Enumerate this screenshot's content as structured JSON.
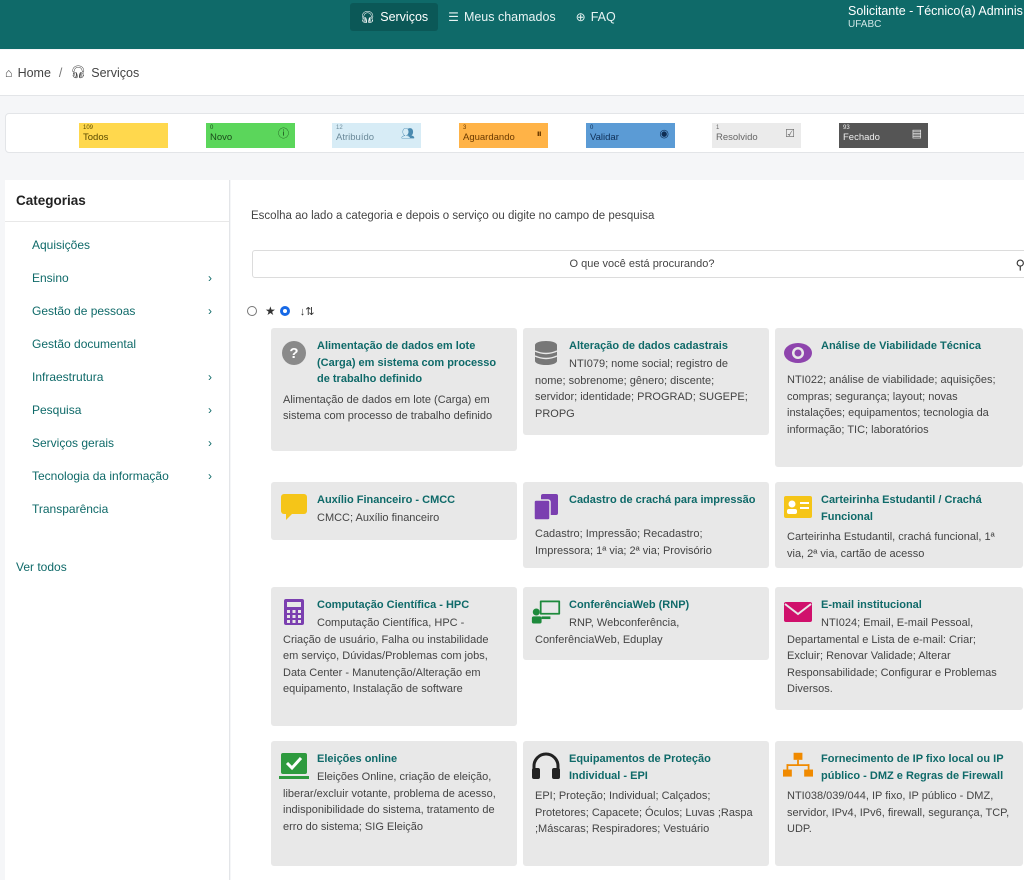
{
  "topbar": {
    "nav": [
      {
        "label": "Serviços",
        "icon": "headset-icon",
        "active": true
      },
      {
        "label": "Meus chamados",
        "icon": "list-icon"
      },
      {
        "label": "FAQ",
        "icon": "lifebuoy-icon"
      }
    ],
    "user": {
      "name": "Solicitante - Técnico(a) Adminis...",
      "org": "UFABC"
    }
  },
  "breadcrumb": {
    "home": "Home",
    "sep": "/",
    "current": "Serviços"
  },
  "status_tiles": [
    {
      "count": "109",
      "label": "Todos",
      "color": "#ffd84d"
    },
    {
      "count": "0",
      "label": "Novo",
      "color": "#5bd65b"
    },
    {
      "count": "12",
      "label": "Atribuído",
      "color": "#cfe6f2"
    },
    {
      "count": "3",
      "label": "Aguardando",
      "color": "#ffb347"
    },
    {
      "count": "0",
      "label": "Validar",
      "color": "#5b9bd5"
    },
    {
      "count": "1",
      "label": "Resolvido",
      "color": "#e8e8e8"
    },
    {
      "count": "93",
      "label": "Fechado",
      "color": "#555555"
    }
  ],
  "sidebar": {
    "title": "Categorias",
    "items": [
      {
        "label": "Aquisições",
        "has_children": false
      },
      {
        "label": "Ensino",
        "has_children": true
      },
      {
        "label": "Gestão de pessoas",
        "has_children": true
      },
      {
        "label": "Gestão documental",
        "has_children": false
      },
      {
        "label": "Infraestrutura",
        "has_children": true
      },
      {
        "label": "Pesquisa",
        "has_children": true
      },
      {
        "label": "Serviços gerais",
        "has_children": true
      },
      {
        "label": "Tecnologia da informação",
        "has_children": true
      },
      {
        "label": "Transparência",
        "has_children": false
      }
    ],
    "see_all": "Ver todos"
  },
  "main": {
    "hint": "Escolha ao lado a categoria e depois o serviço ou digite no campo de pesquisa",
    "search_placeholder": "O que você está procurando?",
    "cards": [
      {
        "title": "Alimentação de dados em lote (Carga) em sistema com processo de trabalho definido",
        "desc": "Alimentação de dados em lote (Carga) em sistema com processo de trabalho definido",
        "icon": "question-icon"
      },
      {
        "title": "Alteração de dados cadastrais",
        "desc": "NTI079; nome social; registro de nome; sobrenome; gênero; discente; servidor; identidade; PROGRAD; SUGEPE; PROPG",
        "icon": "database-icon"
      },
      {
        "title": "Análise de Viabilidade Técnica",
        "desc": "NTI022; análise de viabilidade; aquisições; compras; segurança; layout; novas instalações; equipamentos; tecnologia da informação; TIC; laboratórios",
        "icon": "eye-icon"
      },
      {
        "title": "Auxílio Financeiro - CMCC",
        "desc": "CMCC; Auxílio financeiro",
        "icon": "comment-icon"
      },
      {
        "title": "Cadastro de crachá para impressão",
        "desc": "Cadastro; Impressão; Recadastro; Impressora; 1ª via; 2ª via; Provisório",
        "icon": "copy-icon"
      },
      {
        "title": "Carteirinha Estudantil / Crachá Funcional",
        "desc": "Carteirinha Estudantil, crachá funcional, 1ª via, 2ª via, cartão de acesso",
        "icon": "id-card-icon"
      },
      {
        "title": "Computação Científica - HPC",
        "desc": "Computação Científica, HPC - Criação de usuário, Falha ou instabilidade em serviço, Dúvidas/Problemas com jobs, Data Center - Manutenção/Alteração em equipamento, Instalação de software",
        "icon": "calculator-icon"
      },
      {
        "title": "ConferênciaWeb (RNP)",
        "desc": "RNP, Webconferência, ConferênciaWeb, Eduplay",
        "icon": "presentation-icon"
      },
      {
        "title": "E-mail institucional",
        "desc": "NTI024; Email, E-mail Pessoal, Departamental e Lista de e-mail: Criar; Excluir; Renovar Validade; Alterar Responsabilidade; Configurar e Problemas Diversos.",
        "icon": "envelope-icon"
      },
      {
        "title": "Eleições online",
        "desc": "Eleições Online, criação de eleição, liberar/excluir votante, problema de acesso, indisponibilidade do sistema, tratamento de erro do sistema; SIG Eleição",
        "icon": "check-square-icon"
      },
      {
        "title": "Equipamentos de Proteção Individual - EPI",
        "desc": "EPI; Proteção; Individual; Calçados; Protetores; Capacete; Óculos; Luvas ;Raspa ;Máscaras; Respiradores; Vestuário",
        "icon": "headphones-icon"
      },
      {
        "title": "Fornecimento de IP fixo local ou IP público - DMZ e Regras de Firewall",
        "desc": "NTI038/039/044, IP fixo, IP público - DMZ, servidor, IPv4, IPv6, firewall, segurança, TCP, UDP.",
        "icon": "network-icon"
      }
    ]
  }
}
